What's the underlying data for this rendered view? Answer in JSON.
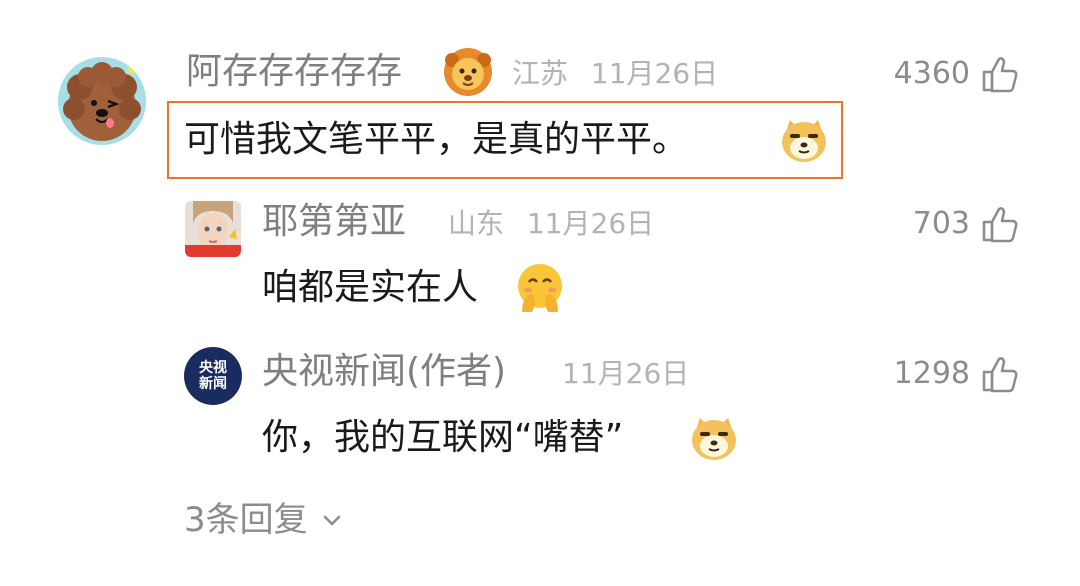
{
  "comment": {
    "author": "阿存存存存存",
    "location": "江苏",
    "date": "11月26日",
    "likes": "4360",
    "text": "可惜我文笔平平，是真的平平。"
  },
  "replies": [
    {
      "author": "耶第第亚",
      "location": "山东",
      "date": "11月26日",
      "likes": "703",
      "text": "咱都是实在人"
    },
    {
      "author": "央视新闻(作者)",
      "date": "11月26日",
      "likes": "1298",
      "text": "你，我的互联网“嘴替”",
      "avatar_text": [
        "央视",
        "新闻"
      ]
    }
  ],
  "more_replies_label": "3条回复",
  "colors": {
    "highlight": "#e8762f",
    "cctv_avatar_bg": "#1a2b5f"
  }
}
